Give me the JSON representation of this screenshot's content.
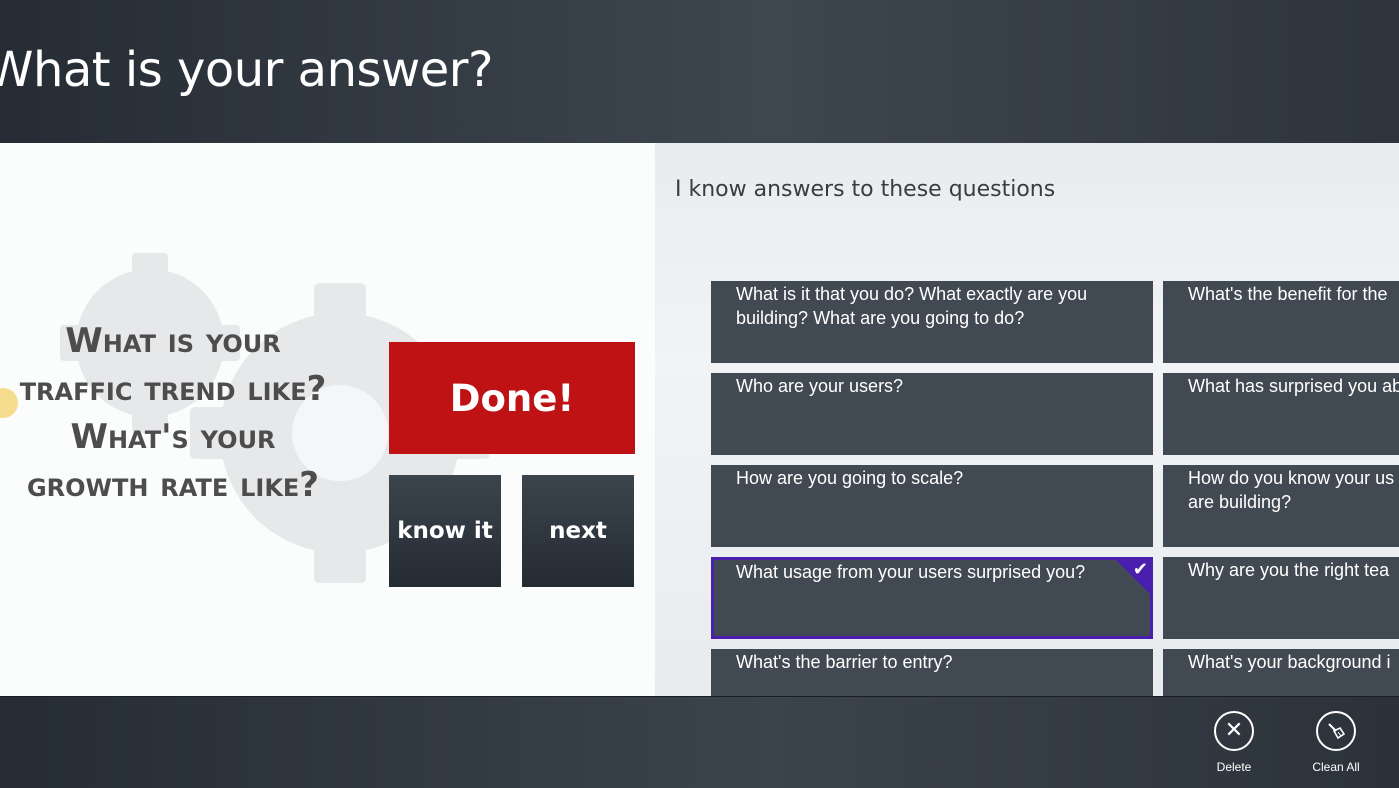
{
  "header": {
    "title": "What is your answer?"
  },
  "card": {
    "lines": [
      "What is your",
      "traffic trend like?",
      "What's your",
      "growth rate like?"
    ]
  },
  "actions": {
    "done": "Done!",
    "know_it": "know it",
    "next": "next"
  },
  "panel": {
    "heading": "I know answers to these questions",
    "col1": [
      "What is it that you do? What exactly are you building? What are you going to do?",
      "Who are your users?",
      "How are you going to scale?",
      "What usage from your users surprised you?",
      "What's the barrier to entry?"
    ],
    "col2": [
      "What's the benefit for the",
      "What has surprised you ab",
      "How do you know your us\nare building?",
      "Why are you the right tea",
      "What's your background i"
    ],
    "selected_index": 3
  },
  "appbar": {
    "delete": "Delete",
    "clean_all": "Clean All"
  },
  "colors": {
    "done_red": "#be1214",
    "selection_purple": "#4b1fae",
    "tile": "#414952"
  }
}
